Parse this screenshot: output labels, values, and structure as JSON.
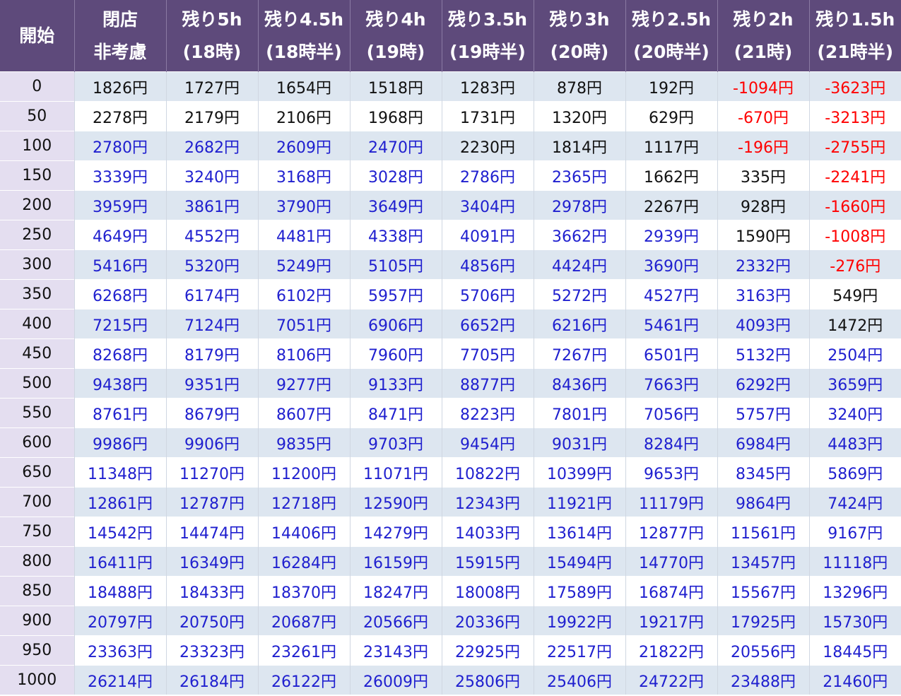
{
  "table": {
    "headers": [
      {
        "line1": "開始",
        "line2": ""
      },
      {
        "line1": "閉店",
        "line2": "非考慮"
      },
      {
        "line1": "残り5h",
        "line2": "(18時)"
      },
      {
        "line1": "残り4.5h",
        "line2": "(18時半)"
      },
      {
        "line1": "残り4h",
        "line2": "(19時)"
      },
      {
        "line1": "残り3.5h",
        "line2": "(19時半)"
      },
      {
        "line1": "残り3h",
        "line2": "(20時)"
      },
      {
        "line1": "残り2.5h",
        "line2": "(20時半)"
      },
      {
        "line1": "残り2h",
        "line2": "(21時)"
      },
      {
        "line1": "残り1.5h",
        "line2": "(21時半)"
      }
    ],
    "colors": {
      "header_bg": "#5e4a7b",
      "start_col_bg": "#e4def0",
      "stripe_bg": "#dde6f0",
      "blue_text": "#1f1fcf",
      "red_text": "#ff0000",
      "black_text": "#111111"
    },
    "rows": [
      {
        "start": "0",
        "values": [
          "1826円",
          "1727円",
          "1654円",
          "1518円",
          "1283円",
          "878円",
          "192円",
          "-1094円",
          "-3623円"
        ],
        "tones": [
          "k",
          "k",
          "k",
          "k",
          "k",
          "k",
          "k",
          "r",
          "r"
        ]
      },
      {
        "start": "50",
        "values": [
          "2278円",
          "2179円",
          "2106円",
          "1968円",
          "1731円",
          "1320円",
          "629円",
          "-670円",
          "-3213円"
        ],
        "tones": [
          "k",
          "k",
          "k",
          "k",
          "k",
          "k",
          "k",
          "r",
          "r"
        ]
      },
      {
        "start": "100",
        "values": [
          "2780円",
          "2682円",
          "2609円",
          "2470円",
          "2230円",
          "1814円",
          "1117円",
          "-196円",
          "-2755円"
        ],
        "tones": [
          "b",
          "b",
          "b",
          "b",
          "k",
          "k",
          "k",
          "r",
          "r"
        ]
      },
      {
        "start": "150",
        "values": [
          "3339円",
          "3240円",
          "3168円",
          "3028円",
          "2786円",
          "2365円",
          "1662円",
          "335円",
          "-2241円"
        ],
        "tones": [
          "b",
          "b",
          "b",
          "b",
          "b",
          "b",
          "k",
          "k",
          "r"
        ]
      },
      {
        "start": "200",
        "values": [
          "3959円",
          "3861円",
          "3790円",
          "3649円",
          "3404円",
          "2978円",
          "2267円",
          "928円",
          "-1660円"
        ],
        "tones": [
          "b",
          "b",
          "b",
          "b",
          "b",
          "b",
          "k",
          "k",
          "r"
        ]
      },
      {
        "start": "250",
        "values": [
          "4649円",
          "4552円",
          "4481円",
          "4338円",
          "4091円",
          "3662円",
          "2939円",
          "1590円",
          "-1008円"
        ],
        "tones": [
          "b",
          "b",
          "b",
          "b",
          "b",
          "b",
          "b",
          "k",
          "r"
        ]
      },
      {
        "start": "300",
        "values": [
          "5416円",
          "5320円",
          "5249円",
          "5105円",
          "4856円",
          "4424円",
          "3690円",
          "2332円",
          "-276円"
        ],
        "tones": [
          "b",
          "b",
          "b",
          "b",
          "b",
          "b",
          "b",
          "b",
          "r"
        ]
      },
      {
        "start": "350",
        "values": [
          "6268円",
          "6174円",
          "6102円",
          "5957円",
          "5706円",
          "5272円",
          "4527円",
          "3163円",
          "549円"
        ],
        "tones": [
          "b",
          "b",
          "b",
          "b",
          "b",
          "b",
          "b",
          "b",
          "k"
        ]
      },
      {
        "start": "400",
        "values": [
          "7215円",
          "7124円",
          "7051円",
          "6906円",
          "6652円",
          "6216円",
          "5461円",
          "4093円",
          "1472円"
        ],
        "tones": [
          "b",
          "b",
          "b",
          "b",
          "b",
          "b",
          "b",
          "b",
          "k"
        ]
      },
      {
        "start": "450",
        "values": [
          "8268円",
          "8179円",
          "8106円",
          "7960円",
          "7705円",
          "7267円",
          "6501円",
          "5132円",
          "2504円"
        ],
        "tones": [
          "b",
          "b",
          "b",
          "b",
          "b",
          "b",
          "b",
          "b",
          "b"
        ]
      },
      {
        "start": "500",
        "values": [
          "9438円",
          "9351円",
          "9277円",
          "9133円",
          "8877円",
          "8436円",
          "7663円",
          "6292円",
          "3659円"
        ],
        "tones": [
          "b",
          "b",
          "b",
          "b",
          "b",
          "b",
          "b",
          "b",
          "b"
        ]
      },
      {
        "start": "550",
        "values": [
          "8761円",
          "8679円",
          "8607円",
          "8471円",
          "8223円",
          "7801円",
          "7056円",
          "5757円",
          "3240円"
        ],
        "tones": [
          "b",
          "b",
          "b",
          "b",
          "b",
          "b",
          "b",
          "b",
          "b"
        ]
      },
      {
        "start": "600",
        "values": [
          "9986円",
          "9906円",
          "9835円",
          "9703円",
          "9454円",
          "9031円",
          "8284円",
          "6984円",
          "4483円"
        ],
        "tones": [
          "b",
          "b",
          "b",
          "b",
          "b",
          "b",
          "b",
          "b",
          "b"
        ]
      },
      {
        "start": "650",
        "values": [
          "11348円",
          "11270円",
          "11200円",
          "11071円",
          "10822円",
          "10399円",
          "9653円",
          "8345円",
          "5869円"
        ],
        "tones": [
          "b",
          "b",
          "b",
          "b",
          "b",
          "b",
          "b",
          "b",
          "b"
        ]
      },
      {
        "start": "700",
        "values": [
          "12861円",
          "12787円",
          "12718円",
          "12590円",
          "12343円",
          "11921円",
          "11179円",
          "9864円",
          "7424円"
        ],
        "tones": [
          "b",
          "b",
          "b",
          "b",
          "b",
          "b",
          "b",
          "b",
          "b"
        ]
      },
      {
        "start": "750",
        "values": [
          "14542円",
          "14474円",
          "14406円",
          "14279円",
          "14033円",
          "13614円",
          "12877円",
          "11561円",
          "9167円"
        ],
        "tones": [
          "b",
          "b",
          "b",
          "b",
          "b",
          "b",
          "b",
          "b",
          "b"
        ]
      },
      {
        "start": "800",
        "values": [
          "16411円",
          "16349円",
          "16284円",
          "16159円",
          "15915円",
          "15494円",
          "14770円",
          "13457円",
          "11118円"
        ],
        "tones": [
          "b",
          "b",
          "b",
          "b",
          "b",
          "b",
          "b",
          "b",
          "b"
        ]
      },
      {
        "start": "850",
        "values": [
          "18488円",
          "18433円",
          "18370円",
          "18247円",
          "18008円",
          "17589円",
          "16874円",
          "15567円",
          "13296円"
        ],
        "tones": [
          "b",
          "b",
          "b",
          "b",
          "b",
          "b",
          "b",
          "b",
          "b"
        ]
      },
      {
        "start": "900",
        "values": [
          "20797円",
          "20750円",
          "20687円",
          "20566円",
          "20336円",
          "19922円",
          "19217円",
          "17925円",
          "15730円"
        ],
        "tones": [
          "b",
          "b",
          "b",
          "b",
          "b",
          "b",
          "b",
          "b",
          "b"
        ]
      },
      {
        "start": "950",
        "values": [
          "23363円",
          "23323円",
          "23261円",
          "23143円",
          "22925円",
          "22517円",
          "21822円",
          "20556円",
          "18445円"
        ],
        "tones": [
          "b",
          "b",
          "b",
          "b",
          "b",
          "b",
          "b",
          "b",
          "b"
        ]
      },
      {
        "start": "1000",
        "values": [
          "26214円",
          "26184円",
          "26122円",
          "26009円",
          "25806円",
          "25406円",
          "24722円",
          "23488円",
          "21460円"
        ],
        "tones": [
          "b",
          "b",
          "b",
          "b",
          "b",
          "b",
          "b",
          "b",
          "b"
        ]
      }
    ]
  }
}
